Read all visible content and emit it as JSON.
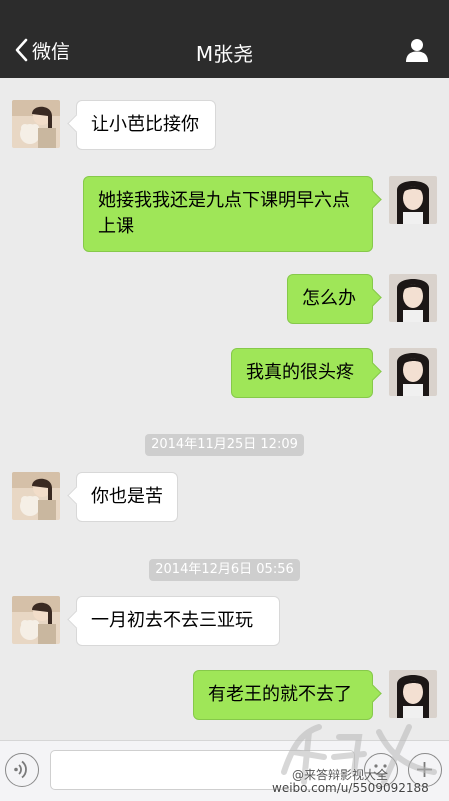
{
  "nav": {
    "back_label": "微信",
    "title": "M张尧"
  },
  "messages": [
    {
      "side": "left",
      "text": "让小芭比接你"
    },
    {
      "side": "right",
      "text": "她接我我还是九点下课明早六点上课"
    },
    {
      "side": "right",
      "text": "怎么办"
    },
    {
      "side": "right",
      "text": "我真的很头疼"
    },
    {
      "timestamp": "2014年11月25日 12:09"
    },
    {
      "side": "left",
      "text": "你也是苦"
    },
    {
      "timestamp": "2014年12月6日 05:56"
    },
    {
      "side": "left",
      "text": "一月初去不去三亚玩"
    },
    {
      "side": "right",
      "text": "有老王的就不去了"
    }
  ],
  "watermark": {
    "weibo": "@来答辩影视大全",
    "url": "weibo.com/u/5509092188"
  },
  "colors": {
    "nav_bg": "#2c2c2c",
    "chat_bg": "#ebebeb",
    "bubble_right": "#9fe658",
    "bubble_left": "#ffffff"
  },
  "icons": {
    "back": "chevron-left-icon",
    "profile": "person-icon",
    "voice": "voice-icon",
    "emoji": "emoji-icon",
    "plus": "plus-icon"
  }
}
